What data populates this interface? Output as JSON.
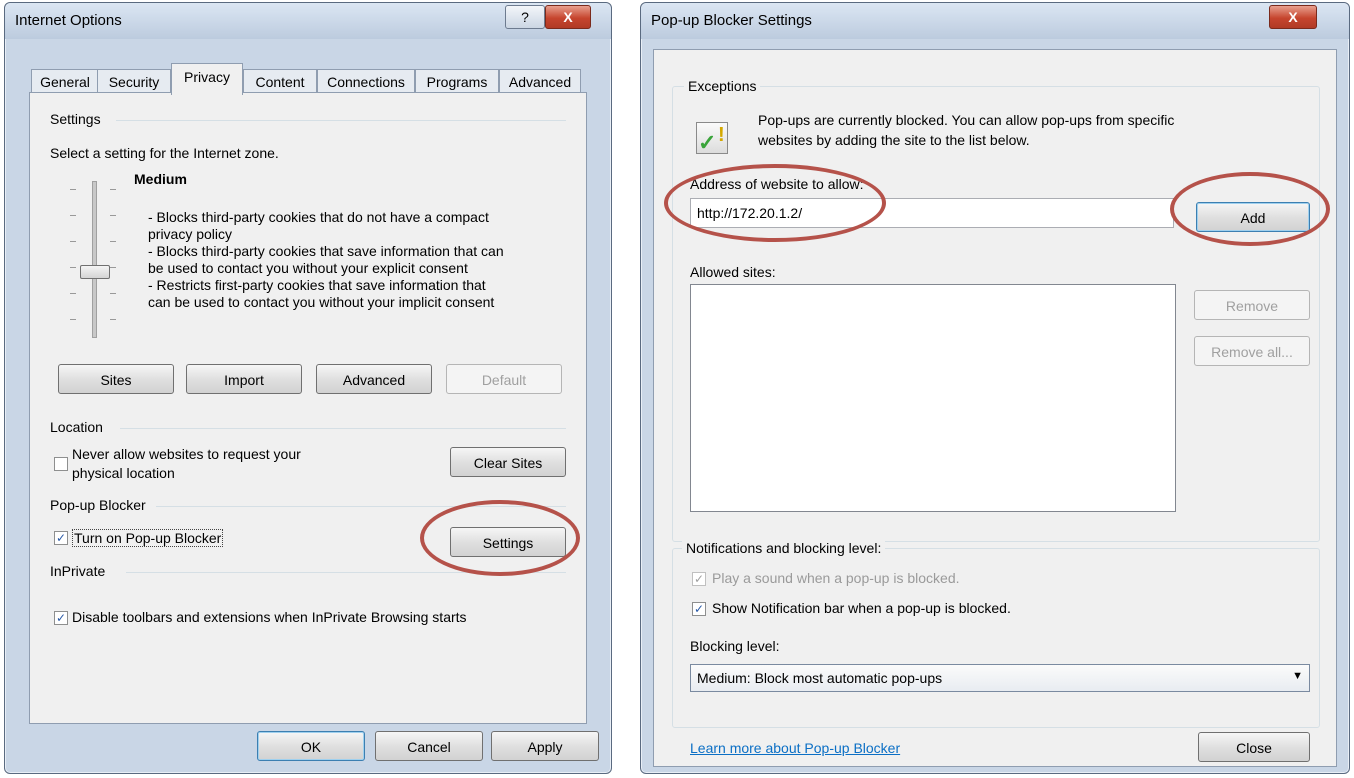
{
  "internet_options": {
    "title": "Internet Options",
    "help_label": "?",
    "close_label": "X",
    "tabs": [
      "General",
      "Security",
      "Privacy",
      "Content",
      "Connections",
      "Programs",
      "Advanced"
    ],
    "settings_group": "Settings",
    "zone_text": "Select a setting for the Internet zone.",
    "level": "Medium",
    "desc": [
      "- Blocks third-party cookies that do not have a compact",
      "privacy policy",
      "- Blocks third-party cookies that save information that can",
      "be used to contact you without your explicit consent",
      "- Restricts first-party cookies that save information that",
      "can be used to contact you without your implicit consent"
    ],
    "buttons": {
      "sites": "Sites",
      "import": "Import",
      "advanced": "Advanced",
      "default": "Default",
      "clear_sites": "Clear Sites",
      "settings": "Settings",
      "ok": "OK",
      "cancel": "Cancel",
      "apply": "Apply"
    },
    "location_group": "Location",
    "location_line1": "Never allow websites to request your",
    "location_line2": "physical location",
    "popup_group": "Pop-up Blocker",
    "popup_checkbox": "Turn on Pop-up Blocker",
    "inprivate_group": "InPrivate",
    "inprivate_checkbox": "Disable toolbars and extensions when InPrivate Browsing starts"
  },
  "popup_settings": {
    "title": "Pop-up Blocker Settings",
    "close_label": "X",
    "exceptions_group": "Exceptions",
    "info_line1": "Pop-ups are currently blocked.  You can allow pop-ups from specific",
    "info_line2": "websites by adding the site to the list below.",
    "address_label": "Address of website to allow:",
    "address_value": "http://172.20.1.2/",
    "add_button": "Add",
    "allowed_label": "Allowed sites:",
    "remove_button": "Remove",
    "remove_all_button": "Remove all...",
    "notifications_group": "Notifications and blocking level:",
    "play_sound": "Play a sound when a pop-up is blocked.",
    "show_bar": "Show Notification bar when a pop-up is blocked.",
    "blocking_label": "Blocking level:",
    "blocking_value": "Medium: Block most automatic pop-ups",
    "learn_more": "Learn more about Pop-up Blocker",
    "close_button": "Close"
  }
}
